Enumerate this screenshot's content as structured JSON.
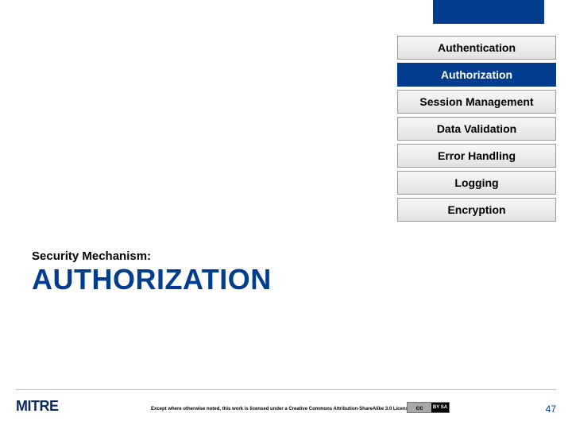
{
  "nav": {
    "items": [
      {
        "label": "Authentication",
        "selected": false
      },
      {
        "label": "Authorization",
        "selected": true
      },
      {
        "label": "Session Management",
        "selected": false
      },
      {
        "label": "Data Validation",
        "selected": false
      },
      {
        "label": "Error Handling",
        "selected": false
      },
      {
        "label": "Logging",
        "selected": false
      },
      {
        "label": "Encryption",
        "selected": false
      }
    ]
  },
  "body": {
    "kicker": "Security Mechanism:",
    "headline": "AUTHORIZATION"
  },
  "footer": {
    "logo": "MITRE",
    "license_text": "Except where otherwise noted, this work is licensed under a Creative Commons Attribution-ShareAlike 3.0 License",
    "cc_left": "cc",
    "cc_right": "BY SA",
    "page_number": "47"
  }
}
